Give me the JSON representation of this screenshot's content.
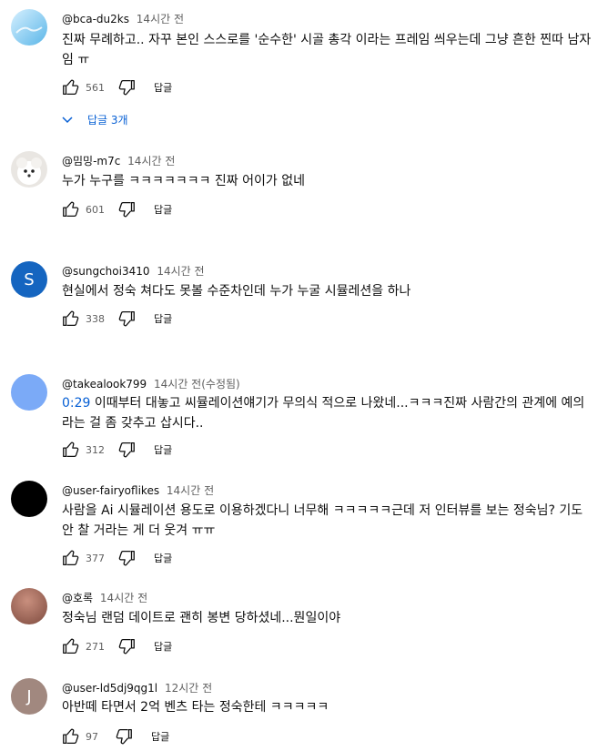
{
  "comments": [
    {
      "author": "@bca-du2ks",
      "time": "14시간 전",
      "text": "진짜 무례하고.. 자꾸 본인 스스로를 '순수한' 시골 총각 이라는 프레임 씌우는데 그냥 흔한 찐따 남자임 ㅠ",
      "likes": "561",
      "reply_label": "답글",
      "replies_label": "답글 3개"
    },
    {
      "author": "@밈밍-m7c",
      "time": "14시간 전",
      "text": "누가 누구를 ㅋㅋㅋㅋㅋㅋㅋ 진짜 어이가 없네",
      "likes": "601",
      "reply_label": "답글"
    },
    {
      "author": "@sungchoi3410",
      "time": "14시간 전",
      "text": "현실에서 정숙 쳐다도 못볼 수준차인데 누가 누굴 시뮬레션을 하나",
      "likes": "338",
      "reply_label": "답글",
      "avatar_letter": "S"
    },
    {
      "author": "@takealook799",
      "time": "14시간 전(수정됨)",
      "timestamp_link": "0:29",
      "text": " 이때부터 대놓고 씨뮬레이션얘기가 무의식 적으로 나왔네...ㅋㅋㅋ진짜 사람간의 관계에 예의라는 걸 좀 갖추고 삽시다..",
      "likes": "312",
      "reply_label": "답글"
    },
    {
      "author": "@user-fairyoflikes",
      "time": "14시간 전",
      "text": "사람을 Ai 시뮬레이션 용도로 이용하겠다니 너무해 ㅋㅋㅋㅋㅋ근데 저 인터뷰를 보는 정숙님? 기도 안 찰 거라는 게 더 웃겨 ㅠㅠ",
      "likes": "377",
      "reply_label": "답글"
    },
    {
      "author": "@호록",
      "time": "14시간 전",
      "text": "정숙님 랜덤 데이트로 괜히 봉변 당하셨네...뭔일이야",
      "likes": "271",
      "reply_label": "답글"
    },
    {
      "author": "@user-ld5dj9qg1l",
      "time": "12시간 전",
      "text": "아반떼 타면서 2억 벤츠 타는 정숙한테 ㅋㅋㅋㅋㅋ",
      "likes": "97",
      "reply_label": "답글",
      "avatar_letter": "J"
    }
  ],
  "colors": {
    "link": "#065fd4",
    "secondary_text": "#606060",
    "avatar_s": "#1565c0",
    "avatar_takealook": "#7baaf7",
    "avatar_fairy": "#000000",
    "avatar_horok": "#a0685a",
    "avatar_j": "#a1887f"
  }
}
